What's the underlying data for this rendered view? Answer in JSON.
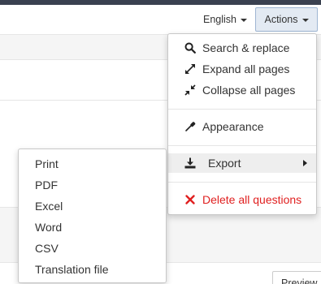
{
  "header": {
    "language_label": "English",
    "actions_label": "Actions"
  },
  "actions_menu": {
    "items": [
      {
        "label": "Search & replace",
        "icon": "search-icon"
      },
      {
        "label": "Expand all pages",
        "icon": "expand-icon"
      },
      {
        "label": "Collapse all pages",
        "icon": "collapse-icon"
      },
      {
        "label": "Appearance",
        "icon": "eyedropper-icon"
      },
      {
        "label": "Export",
        "icon": "download-icon"
      },
      {
        "label": "Delete all questions",
        "icon": "close-icon"
      }
    ]
  },
  "export_submenu": {
    "items": [
      "Print",
      "PDF",
      "Excel",
      "Word",
      "CSV",
      "Translation file"
    ]
  },
  "footer": {
    "preview_label": "Preview"
  },
  "colors": {
    "topbar": "#3a4150",
    "actions_bg": "#e3eaf3",
    "actions_border": "#9fb6d3",
    "danger": "#e02020"
  }
}
